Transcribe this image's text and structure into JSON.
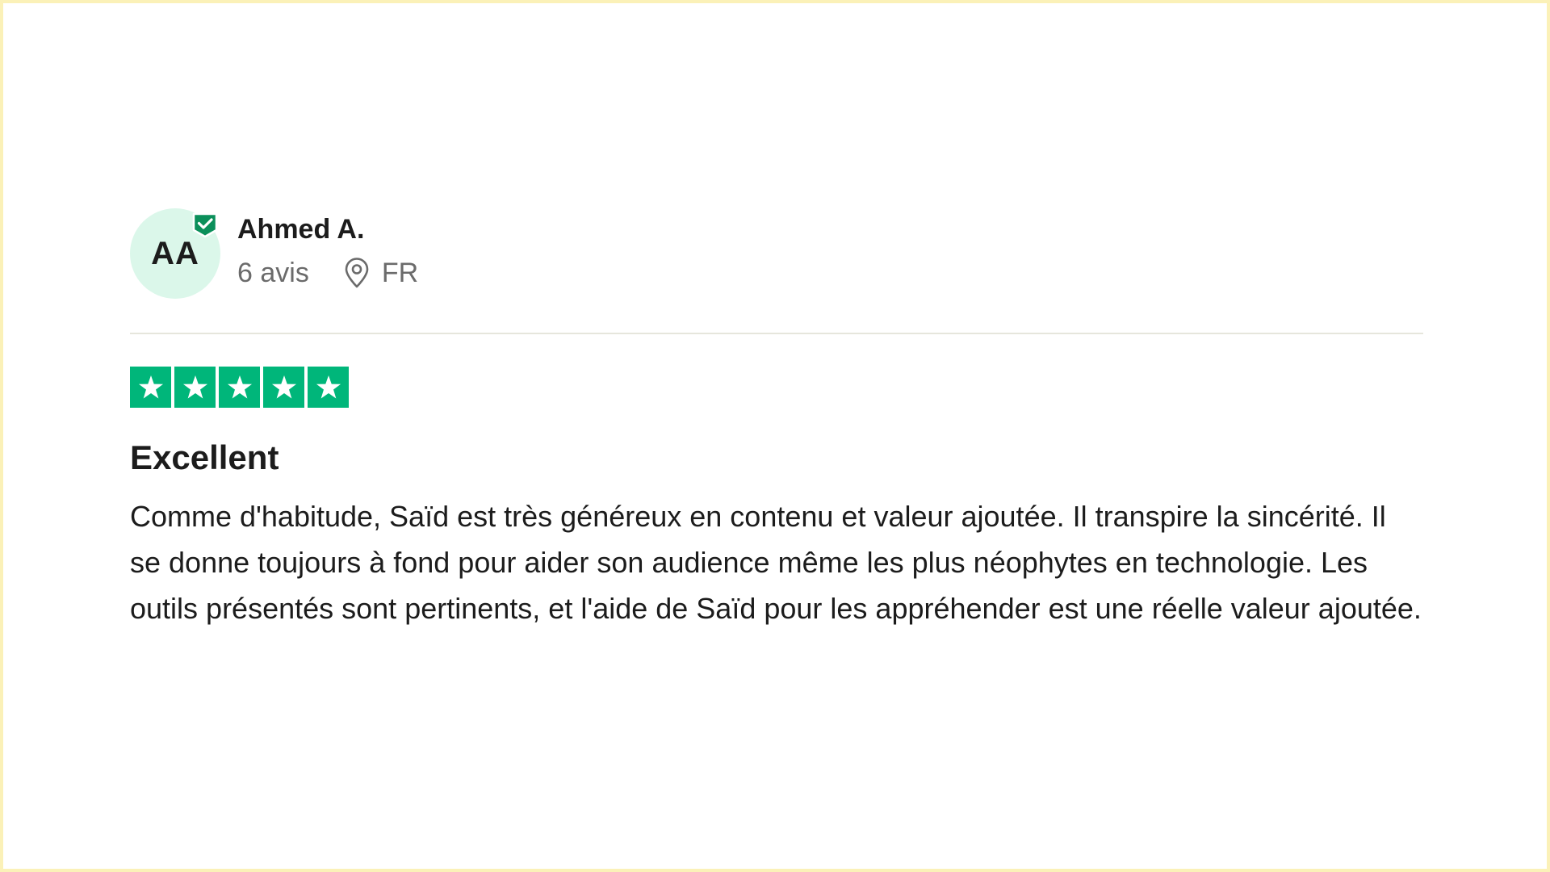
{
  "reviewer": {
    "initials": "AA",
    "name": "Ahmed A.",
    "review_count": "6 avis",
    "country": "FR",
    "verified": true
  },
  "rating": {
    "stars": 5,
    "max": 5,
    "star_color": "#00b67a"
  },
  "review": {
    "title": "Excellent",
    "body": "Comme d'habitude, Saïd est très généreux en contenu et valeur ajoutée. Il transpire la sincérité. Il se donne toujours à fond pour aider son audience même les plus néophytes en technologie. Les outils présentés sont pertinents, et l'aide de Saïd pour les appréhender est une réelle valeur ajoutée."
  },
  "colors": {
    "avatar_bg": "#dbf7ea",
    "verified_badge": "#0b8f5a",
    "frame_border": "#fbf1b8"
  },
  "icons": {
    "verified": "verified-badge-icon",
    "location": "location-pin-icon",
    "star": "star-icon"
  }
}
